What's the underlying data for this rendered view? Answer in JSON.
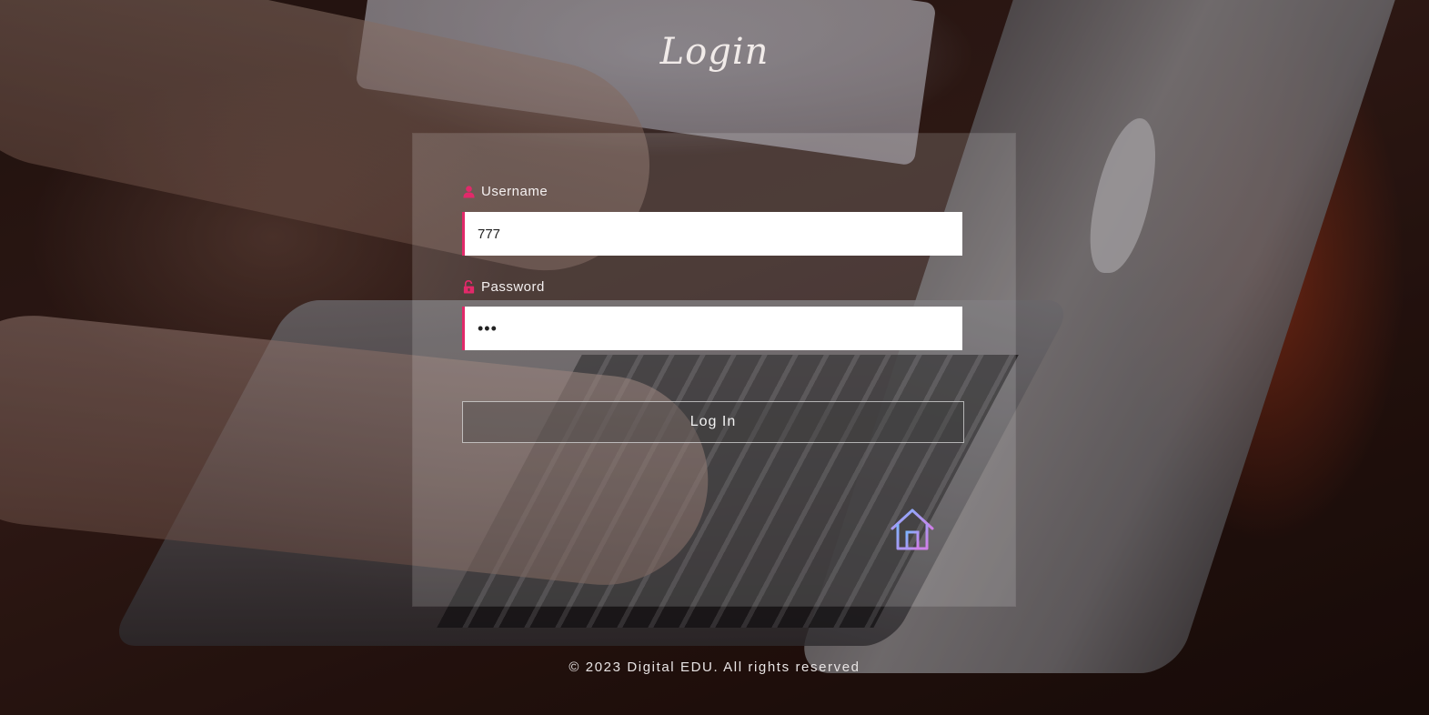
{
  "page": {
    "title": "Login"
  },
  "form": {
    "username": {
      "label": "Username",
      "icon": "user-icon",
      "value": "777"
    },
    "password": {
      "label": "Password",
      "icon": "unlock-icon",
      "value": "•••"
    },
    "submit_label": "Log In",
    "home_icon": "home-icon"
  },
  "footer": {
    "text": "© 2023 Digital EDU. All rights reserved"
  },
  "colors": {
    "accent": "#e2296a",
    "home_icon_gradient": [
      "#7fb4ff",
      "#d17ee8"
    ]
  }
}
